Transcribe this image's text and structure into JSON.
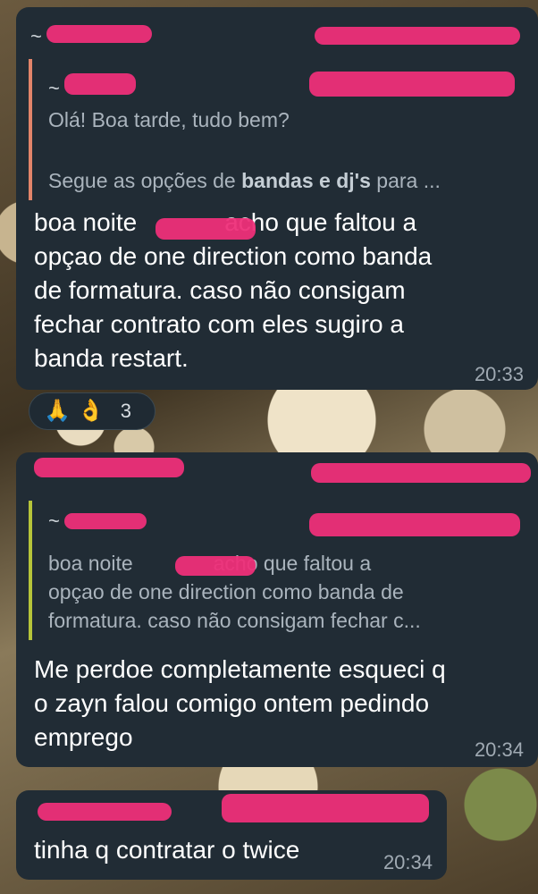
{
  "messages": [
    {
      "reply_preview": {
        "line1": "Olá! Boa tarde, tudo bem?",
        "line2_prefix": "Segue as opções de ",
        "line2_bold": "bandas e dj's",
        "line2_suffix": " para ..."
      },
      "text_line1a": "boa noite",
      "text_line1b": "acho que faltou a",
      "text_line2": "opçao de one direction como banda",
      "text_line3": "de formatura. caso não consigam",
      "text_line4": "fechar contrato com eles sugiro a",
      "text_line5": "banda restart.",
      "time": "20:33",
      "reactions": {
        "emoji1": "🙏",
        "emoji2": "👌",
        "count": "3"
      }
    },
    {
      "reply_preview": {
        "line1a": "boa noite",
        "line1b": "acho que faltou a",
        "line2": "opçao de one direction como banda de",
        "line3": "formatura. caso não consigam fechar c..."
      },
      "text_line1": "Me perdoe completamente esqueci q",
      "text_line2": "o zayn falou comigo ontem pedindo",
      "text_line3": "emprego",
      "time": "20:34"
    },
    {
      "text": "tinha q contratar o twice",
      "time": "20:34"
    }
  ],
  "colors": {
    "bubble": "#212c35",
    "redaction": "#ee2f79",
    "reply_bar_1": "#e2846a",
    "reply_bar_2": "#b6c43a"
  }
}
